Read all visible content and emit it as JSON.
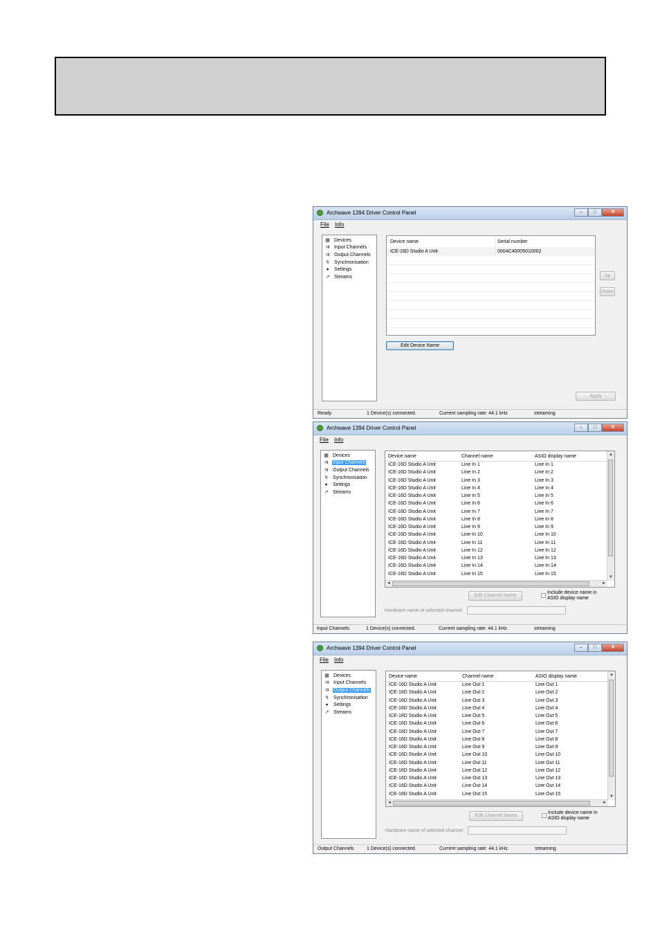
{
  "header_box": {},
  "windows": [
    {
      "title": "Archwave 1394 Driver Control Panel",
      "controls": [
        "‒",
        "□",
        "✕"
      ],
      "menu": [
        "File",
        "Info"
      ],
      "tree": [
        {
          "label": "Devices",
          "icon": "devices-icon"
        },
        {
          "label": "Input Channels",
          "icon": "input-channels-icon"
        },
        {
          "label": "Output Channels",
          "icon": "output-channels-icon"
        },
        {
          "label": "Synchronisation",
          "icon": "synchronisation-icon"
        },
        {
          "label": "Settings",
          "icon": "settings-icon"
        },
        {
          "label": "Streams",
          "icon": "streams-icon"
        }
      ],
      "selected": null,
      "device_table": {
        "headers": [
          "Device name",
          "Serial number"
        ],
        "rows": [
          [
            "ICE-16D Studio A Unit",
            "0004C40005010002"
          ]
        ]
      },
      "buttons": {
        "edit_device_name": "Edit Device Name",
        "up": "Up",
        "down": "Down",
        "apply": "Apply"
      },
      "status": [
        "Ready",
        "1 Device(s) connected.",
        "Current sampling rate: 44.1 kHz",
        "streaming"
      ]
    },
    {
      "title": "Archwave 1394 Driver Control Panel",
      "controls": [
        "‒",
        "□",
        "✕"
      ],
      "menu": [
        "File",
        "Info"
      ],
      "tree": [
        {
          "label": "Devices",
          "icon": "devices-icon"
        },
        {
          "label": "Input Channels",
          "icon": "input-channels-icon"
        },
        {
          "label": "Output Channels",
          "icon": "output-channels-icon"
        },
        {
          "label": "Synchronisation",
          "icon": "synchronisation-icon"
        },
        {
          "label": "Settings",
          "icon": "settings-icon"
        },
        {
          "label": "Streams",
          "icon": "streams-icon"
        }
      ],
      "selected": 1,
      "channel_table": {
        "headers": [
          "Device name",
          "Channel name",
          "ASIO display name"
        ],
        "rows": [
          [
            "ICE-16D Studio A Unit",
            "Line In 1",
            "Line In 1"
          ],
          [
            "ICE-16D Studio A Unit",
            "Line In 2",
            "Line In 2"
          ],
          [
            "ICE-16D Studio A Unit",
            "Line In 3",
            "Line In 3"
          ],
          [
            "ICE-16D Studio A Unit",
            "Line In 4",
            "Line In 4"
          ],
          [
            "ICE-16D Studio A Unit",
            "Line In 5",
            "Line In 5"
          ],
          [
            "ICE-16D Studio A Unit",
            "Line In 6",
            "Line In 6"
          ],
          [
            "ICE-16D Studio A Unit",
            "Line In 7",
            "Line In 7"
          ],
          [
            "ICE-16D Studio A Unit",
            "Line In 8",
            "Line In 8"
          ],
          [
            "ICE-16D Studio A Unit",
            "Line In 9",
            "Line In 9"
          ],
          [
            "ICE-16D Studio A Unit",
            "Line In 10",
            "Line In 10"
          ],
          [
            "ICE-16D Studio A Unit",
            "Line In 11",
            "Line In 11"
          ],
          [
            "ICE-16D Studio A Unit",
            "Line In 12",
            "Line In 12"
          ],
          [
            "ICE-16D Studio A Unit",
            "Line In 13",
            "Line In 13"
          ],
          [
            "ICE-16D Studio A Unit",
            "Line In 14",
            "Line In 14"
          ],
          [
            "ICE-16D Studio A Unit",
            "Line In 15",
            "Line In 15"
          ]
        ]
      },
      "edit_channel_name": "Edit Channel Name",
      "include_line1": "Include device name in",
      "include_line2": "ASIO display name",
      "hardware_label": "Hardware name of selected channel",
      "status": [
        "Input Channels",
        "1 Device(s) connected.",
        "Current sampling rate: 44.1 kHz",
        "streaming"
      ]
    },
    {
      "title": "Archwave 1394 Driver Control Panel",
      "controls": [
        "‒",
        "□",
        "✕"
      ],
      "menu": [
        "File",
        "Info"
      ],
      "tree": [
        {
          "label": "Devices",
          "icon": "devices-icon"
        },
        {
          "label": "Input Channels",
          "icon": "input-channels-icon"
        },
        {
          "label": "Output Channels",
          "icon": "output-channels-icon"
        },
        {
          "label": "Synchronisation",
          "icon": "synchronisation-icon"
        },
        {
          "label": "Settings",
          "icon": "settings-icon"
        },
        {
          "label": "Streams",
          "icon": "streams-icon"
        }
      ],
      "selected": 2,
      "channel_table": {
        "headers": [
          "Device name",
          "Channel name",
          "ASIO display name"
        ],
        "rows": [
          [
            "ICE-16D Studio A Unit",
            "Line Out 1",
            "Line Out 1"
          ],
          [
            "ICE-16D Studio A Unit",
            "Line Out 2",
            "Line Out 2"
          ],
          [
            "ICE-16D Studio A Unit",
            "Line Out 3",
            "Line Out 3"
          ],
          [
            "ICE-16D Studio A Unit",
            "Line Out 4",
            "Line Out 4"
          ],
          [
            "ICE-16D Studio A Unit",
            "Line Out 5",
            "Line Out 5"
          ],
          [
            "ICE-16D Studio A Unit",
            "Line Out 6",
            "Line Out 6"
          ],
          [
            "ICE-16D Studio A Unit",
            "Line Out 7",
            "Line Out 7"
          ],
          [
            "ICE-16D Studio A Unit",
            "Line Out 8",
            "Line Out 8"
          ],
          [
            "ICE-16D Studio A Unit",
            "Line Out 9",
            "Line Out 9"
          ],
          [
            "ICE-16D Studio A Unit",
            "Line Out 10",
            "Line Out 10"
          ],
          [
            "ICE-16D Studio A Unit",
            "Line Out 11",
            "Line Out 11"
          ],
          [
            "ICE-16D Studio A Unit",
            "Line Out 12",
            "Line Out 12"
          ],
          [
            "ICE-16D Studio A Unit",
            "Line Out 13",
            "Line Out 13"
          ],
          [
            "ICE-16D Studio A Unit",
            "Line Out 14",
            "Line Out 14"
          ],
          [
            "ICE-16D Studio A Unit",
            "Line Out 15",
            "Line Out 15"
          ]
        ]
      },
      "edit_channel_name": "Edit Channel Name",
      "include_line1": "Include device name in",
      "include_line2": "ASIO display name",
      "hardware_label": "Hardware name of selected channel",
      "status": [
        "Output Channels",
        "1 Device(s) connected.",
        "Current sampling rate: 44.1 kHz",
        "streaming"
      ]
    }
  ]
}
